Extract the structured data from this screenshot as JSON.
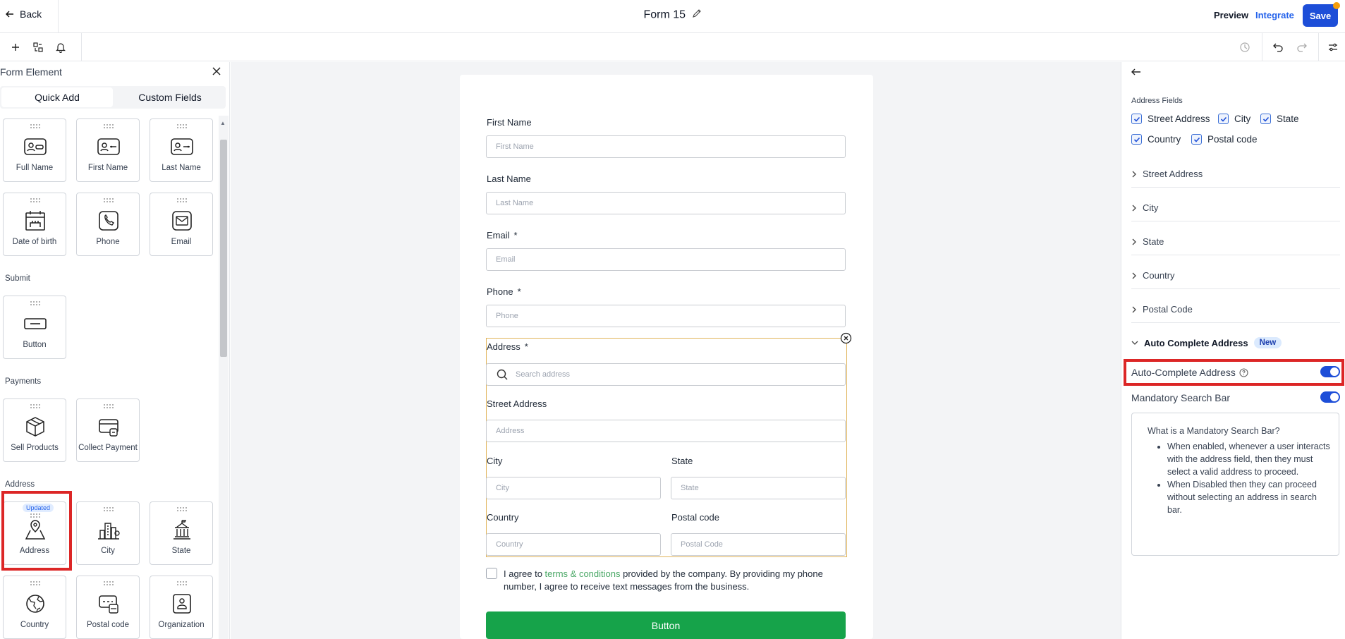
{
  "header": {
    "back_label": "Back",
    "form_title": "Form 15",
    "preview_label": "Preview",
    "integrate_label": "Integrate",
    "save_label": "Save"
  },
  "left_panel": {
    "title": "Form Element",
    "tabs": [
      "Quick Add",
      "Custom Fields"
    ],
    "active_tab": "Quick Add",
    "personal_items": [
      "Full Name",
      "First Name",
      "Last Name",
      "Date of birth",
      "Phone",
      "Email"
    ],
    "submit_section": "Submit",
    "submit_items": [
      "Button"
    ],
    "payments_section": "Payments",
    "payments_items": [
      "Sell Products",
      "Collect Payment"
    ],
    "address_section": "Address",
    "address_items": [
      "Address",
      "City",
      "State",
      "Country",
      "Postal code",
      "Organization"
    ],
    "updated_badge": "Updated"
  },
  "form": {
    "first_name_label": "First Name",
    "first_name_placeholder": "First Name",
    "last_name_label": "Last Name",
    "last_name_placeholder": "Last Name",
    "email_label": "Email",
    "email_placeholder": "Email",
    "phone_label": "Phone",
    "phone_placeholder": "Phone",
    "required_mark": "*",
    "address_label": "Address",
    "search_placeholder": "Search address",
    "street_label": "Street Address",
    "street_placeholder": "Address",
    "city_label": "City",
    "city_placeholder": "City",
    "state_label": "State",
    "state_placeholder": "State",
    "country_label": "Country",
    "country_placeholder": "Country",
    "postal_label": "Postal code",
    "postal_placeholder": "Postal Code",
    "agree_prefix": "I agree to ",
    "agree_link": "terms & conditions",
    "agree_suffix": " provided by the company. By providing my phone number, I agree to receive text messages from the business.",
    "button_label": "Button"
  },
  "right_panel": {
    "address_fields_label": "Address Fields",
    "checkboxes": [
      "Street Address",
      "City",
      "State",
      "Country",
      "Postal code"
    ],
    "accordions": [
      "Street Address",
      "City",
      "State",
      "Country",
      "Postal Code"
    ],
    "auto_complete_section": "Auto Complete Address",
    "new_badge": "New",
    "auto_complete_toggle_label": "Auto-Complete Address",
    "auto_complete_enabled": true,
    "mandatory_toggle_label": "Mandatory Search Bar",
    "mandatory_enabled": true,
    "info_title": "What is a Mandatory Search Bar?",
    "info_points": [
      "When enabled, whenever a user interacts with the address field, then they must select a valid address to proceed.",
      "When Disabled then they can proceed without selecting an address in search bar."
    ]
  },
  "colors": {
    "primary": "#1d4ed8",
    "submit_button": "#16a34a",
    "highlight": "#dc2626",
    "address_outline": "#e0b45a"
  }
}
